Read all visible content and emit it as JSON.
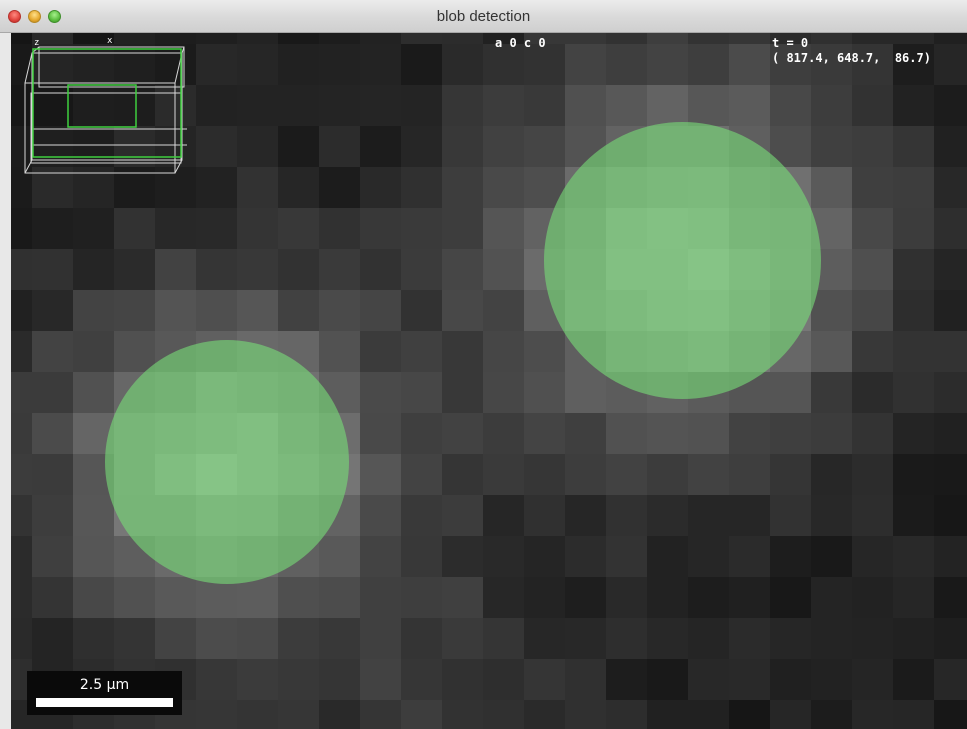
{
  "window": {
    "title": "blob detection"
  },
  "overlay": {
    "angle_channel": "a 0 c 0",
    "timepoint": "t = 0",
    "coordinates": "( 817.4, 648.7,  86.7)"
  },
  "navigator": {
    "axis_z": "z",
    "axis_x": "x",
    "box_color": "#d8d8d8",
    "view_color": "#3ecf3e"
  },
  "scalebar": {
    "label": "2.5 µm"
  },
  "blobs": {
    "count": 2,
    "color": "#78dc78"
  },
  "colors": {
    "background": "#232323"
  }
}
